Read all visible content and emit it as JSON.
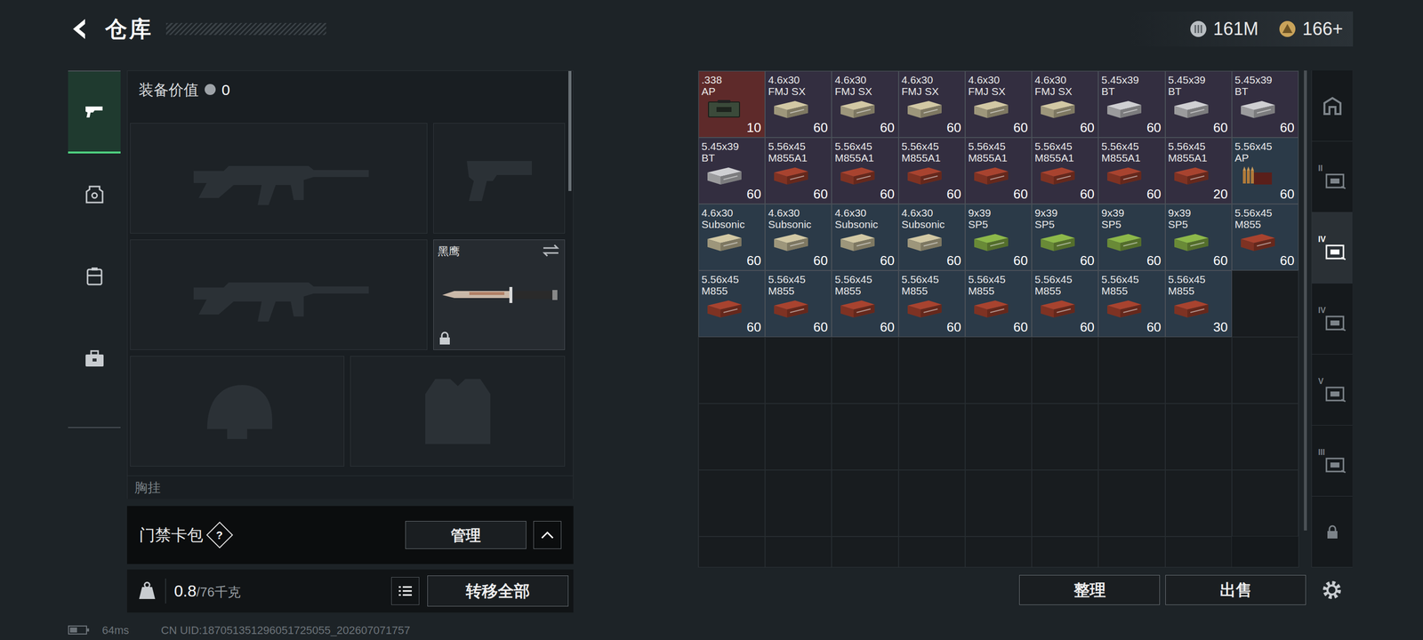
{
  "header": {
    "title": "仓库",
    "currencies": [
      {
        "kind": "coin",
        "value": "161M"
      },
      {
        "kind": "bond",
        "value": "166+"
      }
    ]
  },
  "nav": [
    {
      "kind": "weapon",
      "selected": true
    },
    {
      "kind": "armor",
      "selected": false
    },
    {
      "kind": "rig",
      "selected": false
    },
    {
      "kind": "case",
      "selected": false
    }
  ],
  "equipment": {
    "label": "装备价值",
    "value": "0",
    "slots": [
      {
        "kind": "rifle",
        "name": "",
        "empty": true,
        "locked": false
      },
      {
        "kind": "pistol",
        "name": "",
        "empty": true,
        "locked": false
      },
      {
        "kind": "rifle",
        "name": "",
        "empty": true,
        "locked": false
      },
      {
        "kind": "knife",
        "name": "黑鹰",
        "empty": false,
        "locked": true
      },
      {
        "kind": "helmet",
        "name": "",
        "empty": true,
        "locked": false
      },
      {
        "kind": "armor",
        "name": "",
        "empty": true,
        "locked": false
      }
    ],
    "rig_label": "胸挂"
  },
  "keycard": {
    "label": "门禁卡包",
    "help": "?",
    "button": "管理",
    "expanded": false
  },
  "weight": {
    "current": "0.8",
    "capacity": "/76千克"
  },
  "transfer_button": "转移全部",
  "stash": {
    "rows": [
      [
        {
          "caliber": ".338",
          "type": "AP",
          "count": "10",
          "color": "#5e2a2a",
          "box_color": "#3b4a3a",
          "kind": "can"
        },
        {
          "caliber": "4.6x30",
          "type": "FMJ SX",
          "count": "60",
          "color": "#332e40",
          "box_color": "#d2c8a4",
          "kind": "box"
        },
        {
          "caliber": "4.6x30",
          "type": "FMJ SX",
          "count": "60",
          "color": "#332e40",
          "box_color": "#d2c8a4",
          "kind": "box"
        },
        {
          "caliber": "4.6x30",
          "type": "FMJ SX",
          "count": "60",
          "color": "#332e40",
          "box_color": "#d2c8a4",
          "kind": "box"
        },
        {
          "caliber": "4.6x30",
          "type": "FMJ SX",
          "count": "60",
          "color": "#332e40",
          "box_color": "#d2c8a4",
          "kind": "box"
        },
        {
          "caliber": "4.6x30",
          "type": "FMJ SX",
          "count": "60",
          "color": "#332e40",
          "box_color": "#d2c8a4",
          "kind": "box"
        },
        {
          "caliber": "5.45x39",
          "type": "BT",
          "count": "60",
          "color": "#332e40",
          "box_color": "#cfcfd2",
          "kind": "box"
        },
        {
          "caliber": "5.45x39",
          "type": "BT",
          "count": "60",
          "color": "#332e40",
          "box_color": "#cfcfd2",
          "kind": "box"
        },
        {
          "caliber": "5.45x39",
          "type": "BT",
          "count": "60",
          "color": "#332e40",
          "box_color": "#cfcfd2",
          "kind": "box"
        }
      ],
      [
        {
          "caliber": "5.45x39",
          "type": "BT",
          "count": "60",
          "color": "#332e40",
          "box_color": "#cfcfd2",
          "kind": "box"
        },
        {
          "caliber": "5.56x45",
          "type": "M855A1",
          "count": "60",
          "color": "#332e40",
          "box_color": "#a8432f",
          "kind": "box"
        },
        {
          "caliber": "5.56x45",
          "type": "M855A1",
          "count": "60",
          "color": "#332e40",
          "box_color": "#a8432f",
          "kind": "box"
        },
        {
          "caliber": "5.56x45",
          "type": "M855A1",
          "count": "60",
          "color": "#332e40",
          "box_color": "#a8432f",
          "kind": "box"
        },
        {
          "caliber": "5.56x45",
          "type": "M855A1",
          "count": "60",
          "color": "#332e40",
          "box_color": "#a8432f",
          "kind": "box"
        },
        {
          "caliber": "5.56x45",
          "type": "M855A1",
          "count": "60",
          "color": "#332e40",
          "box_color": "#a8432f",
          "kind": "box"
        },
        {
          "caliber": "5.56x45",
          "type": "M855A1",
          "count": "60",
          "color": "#332e40",
          "box_color": "#a8432f",
          "kind": "box"
        },
        {
          "caliber": "5.56x45",
          "type": "M855A1",
          "count": "20",
          "color": "#332e40",
          "box_color": "#a8432f",
          "kind": "box"
        }
      ],
      [
        {
          "caliber": "5.56x45",
          "type": "AP",
          "count": "60",
          "color": "#2b3a48",
          "box_color": "#b07a3a",
          "kind": "rounds"
        },
        {
          "caliber": "4.6x30",
          "type": "Subsonic",
          "count": "60",
          "color": "#2b3a48",
          "box_color": "#d2c8a4",
          "kind": "box"
        },
        {
          "caliber": "4.6x30",
          "type": "Subsonic",
          "count": "60",
          "color": "#2b3a48",
          "box_color": "#d2c8a4",
          "kind": "box"
        },
        {
          "caliber": "4.6x30",
          "type": "Subsonic",
          "count": "60",
          "color": "#2b3a48",
          "box_color": "#d2c8a4",
          "kind": "box"
        },
        {
          "caliber": "4.6x30",
          "type": "Subsonic",
          "count": "60",
          "color": "#2b3a48",
          "box_color": "#d2c8a4",
          "kind": "box"
        },
        {
          "caliber": "9x39",
          "type": "SP5",
          "count": "60",
          "color": "#2b3a48",
          "box_color": "#8db84a",
          "kind": "box"
        },
        {
          "caliber": "9x39",
          "type": "SP5",
          "count": "60",
          "color": "#2b3a48",
          "box_color": "#8db84a",
          "kind": "box"
        },
        {
          "caliber": "9x39",
          "type": "SP5",
          "count": "60",
          "color": "#2b3a48",
          "box_color": "#8db84a",
          "kind": "box"
        },
        {
          "caliber": "9x39",
          "type": "SP5",
          "count": "60",
          "color": "#2b3a48",
          "box_color": "#8db84a",
          "kind": "box"
        }
      ],
      [
        {
          "caliber": "5.56x45",
          "type": "M855",
          "count": "60",
          "color": "#2b3a48",
          "box_color": "#a8432f",
          "kind": "box"
        },
        {
          "caliber": "5.56x45",
          "type": "M855",
          "count": "60",
          "color": "#2b3a48",
          "box_color": "#a8432f",
          "kind": "box"
        },
        {
          "caliber": "5.56x45",
          "type": "M855",
          "count": "60",
          "color": "#2b3a48",
          "box_color": "#a8432f",
          "kind": "box"
        },
        {
          "caliber": "5.56x45",
          "type": "M855",
          "count": "60",
          "color": "#2b3a48",
          "box_color": "#a8432f",
          "kind": "box"
        },
        {
          "caliber": "5.56x45",
          "type": "M855",
          "count": "60",
          "color": "#2b3a48",
          "box_color": "#a8432f",
          "kind": "box"
        },
        {
          "caliber": "5.56x45",
          "type": "M855",
          "count": "60",
          "color": "#2b3a48",
          "box_color": "#a8432f",
          "kind": "box"
        },
        {
          "caliber": "5.56x45",
          "type": "M855",
          "count": "60",
          "color": "#2b3a48",
          "box_color": "#a8432f",
          "kind": "box"
        },
        {
          "caliber": "5.56x45",
          "type": "M855",
          "count": "60",
          "color": "#2b3a48",
          "box_color": "#a8432f",
          "kind": "box"
        },
        {
          "caliber": "5.56x45",
          "type": "M855",
          "count": "30",
          "color": "#2b3a48",
          "box_color": "#a8432f",
          "kind": "box"
        }
      ]
    ]
  },
  "sidebar": [
    {
      "kind": "base",
      "label": "",
      "selected": false
    },
    {
      "kind": "tier",
      "label": "II",
      "selected": false
    },
    {
      "kind": "tier",
      "label": "IV",
      "selected": true
    },
    {
      "kind": "tier",
      "label": "IV",
      "selected": false
    },
    {
      "kind": "tier",
      "label": "V",
      "selected": false
    },
    {
      "kind": "tier",
      "label": "III",
      "selected": false
    },
    {
      "kind": "lock",
      "label": "",
      "selected": false
    }
  ],
  "actions": [
    "整理",
    "出售"
  ],
  "status": {
    "ping": "64ms",
    "uid": "CN UID:187051351296051725055_202607071757"
  }
}
